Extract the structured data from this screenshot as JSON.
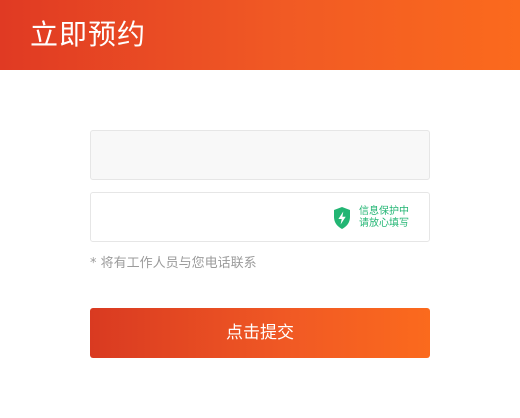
{
  "header": {
    "title": "立即预约"
  },
  "form": {
    "name_field": {
      "value": "",
      "placeholder": ""
    },
    "phone_field": {
      "value": "",
      "placeholder": "",
      "privacy_badge": {
        "icon": "shield-lightning-icon",
        "line1": "信息保护中",
        "line2": "请放心填写",
        "color": "#22b573"
      }
    },
    "hint": "* 将有工作人员与您电话联系",
    "submit_label": "点击提交"
  },
  "colors": {
    "accent_start": "#e03a23",
    "accent_end": "#fb6a1d",
    "privacy_green": "#22b573"
  }
}
